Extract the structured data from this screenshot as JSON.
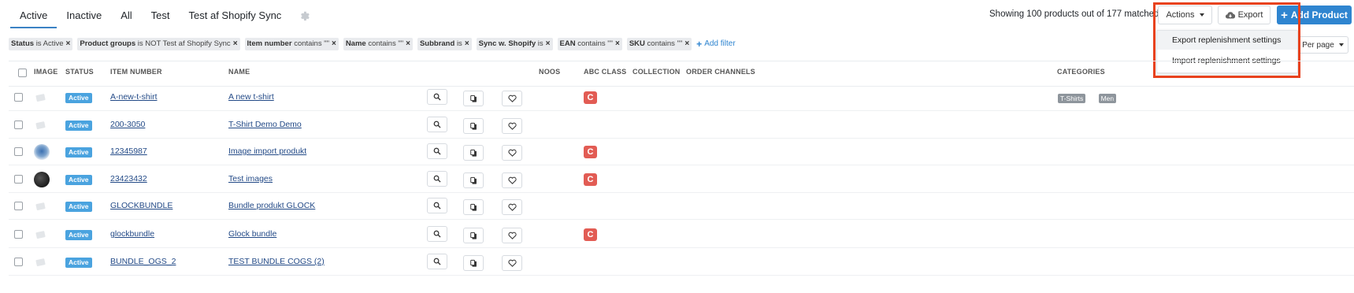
{
  "tabs": [
    {
      "label": "Active"
    },
    {
      "label": "Inactive"
    },
    {
      "label": "All"
    },
    {
      "label": "Test"
    },
    {
      "label": "Test af Shopify Sync"
    }
  ],
  "header": {
    "showing_text": "Showing 100 products out of 177 matched",
    "actions_label": "Actions",
    "export_label": "Export",
    "add_product_label": "Add Product",
    "per_page_label": "Per page"
  },
  "actions_menu": {
    "items": [
      {
        "label": "Export replenishment settings"
      },
      {
        "label": "Import replenishment settings"
      }
    ]
  },
  "filters": [
    {
      "field": "Status",
      "op": "is Active"
    },
    {
      "field": "Product groups",
      "op": "is NOT Test af Shopify Sync"
    },
    {
      "field": "Item number",
      "op": "contains \"\""
    },
    {
      "field": "Name",
      "op": "contains \"\""
    },
    {
      "field": "Subbrand",
      "op": "is"
    },
    {
      "field": "Sync w. Shopify",
      "op": "is"
    },
    {
      "field": "EAN",
      "op": "contains \"\""
    },
    {
      "field": "SKU",
      "op": "contains \"\""
    }
  ],
  "add_filter_label": "Add filter",
  "columns": {
    "image": "IMAGE",
    "status": "STATUS",
    "item_number": "ITEM NUMBER",
    "name": "NAME",
    "noos": "NOOS",
    "abc_class": "ABC CLASS",
    "collection": "COLLECTION",
    "order_channels": "ORDER CHANNELS",
    "categories": "CATEGORIES"
  },
  "rows": [
    {
      "status": "Active",
      "item_number": "A-new-t-shirt",
      "name": "A new t-shirt",
      "abc": "C",
      "categories": [
        "T-Shirts",
        "Men"
      ],
      "image": "placeholder"
    },
    {
      "status": "Active",
      "item_number": "200-3050",
      "name": "T-Shirt Demo Demo",
      "abc": "",
      "categories": [],
      "image": "placeholder"
    },
    {
      "status": "Active",
      "item_number": "12345987",
      "name": "Image import produkt",
      "abc": "C",
      "categories": [],
      "image": "photo-blue"
    },
    {
      "status": "Active",
      "item_number": "23423432",
      "name": "Test images",
      "abc": "C",
      "categories": [],
      "image": "photo-dark"
    },
    {
      "status": "Active",
      "item_number": "GLOCKBUNDLE",
      "name": "Bundle produkt GLOCK",
      "abc": "",
      "categories": [],
      "image": "placeholder"
    },
    {
      "status": "Active",
      "item_number": "glockbundle",
      "name": "Glock bundle",
      "abc": "C",
      "categories": [],
      "image": "placeholder"
    },
    {
      "status": "Active",
      "item_number": "BUNDLE_OGS_2",
      "name": "TEST BUNDLE COGS (2)",
      "abc": "",
      "categories": [],
      "image": "placeholder"
    }
  ],
  "colors": {
    "accent": "#2f85d0",
    "status_badge": "#4aa3df",
    "abc_badge": "#e25c54",
    "highlight": "#e8421e"
  }
}
